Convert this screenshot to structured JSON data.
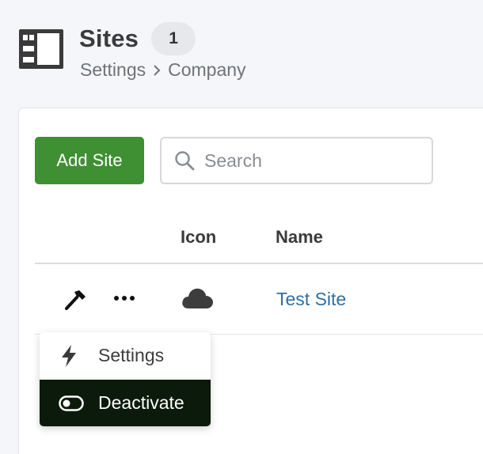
{
  "header": {
    "title": "Sites",
    "count": "1",
    "breadcrumb": [
      "Settings",
      "Company"
    ],
    "icon": "sites-page-icon"
  },
  "toolbar": {
    "add_label": "Add Site",
    "search_placeholder": "Search",
    "search_value": ""
  },
  "table": {
    "columns": [
      "",
      "",
      "Icon",
      "Name"
    ],
    "rows": [
      {
        "actions_icon": "hammer-icon",
        "more_icon": "more-icon",
        "icon": "cloud-icon",
        "name": "Test Site"
      }
    ]
  },
  "action_menu": {
    "items": [
      {
        "label": "Settings",
        "icon": "lightning-icon"
      },
      {
        "label": "Deactivate",
        "icon": "toggle-icon",
        "highlighted": true
      }
    ]
  },
  "colors": {
    "primary_button": "#3f8f33",
    "link": "#2f6fa3",
    "menu_highlight": "#0c1a0b"
  }
}
